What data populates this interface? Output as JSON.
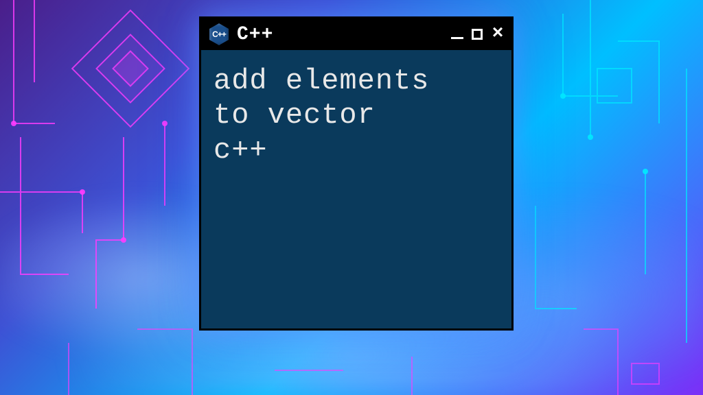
{
  "titlebar": {
    "icon_label": "C++",
    "title": "C++"
  },
  "content": {
    "line1": "add elements",
    "line2": "to vector",
    "line3": "c++"
  }
}
